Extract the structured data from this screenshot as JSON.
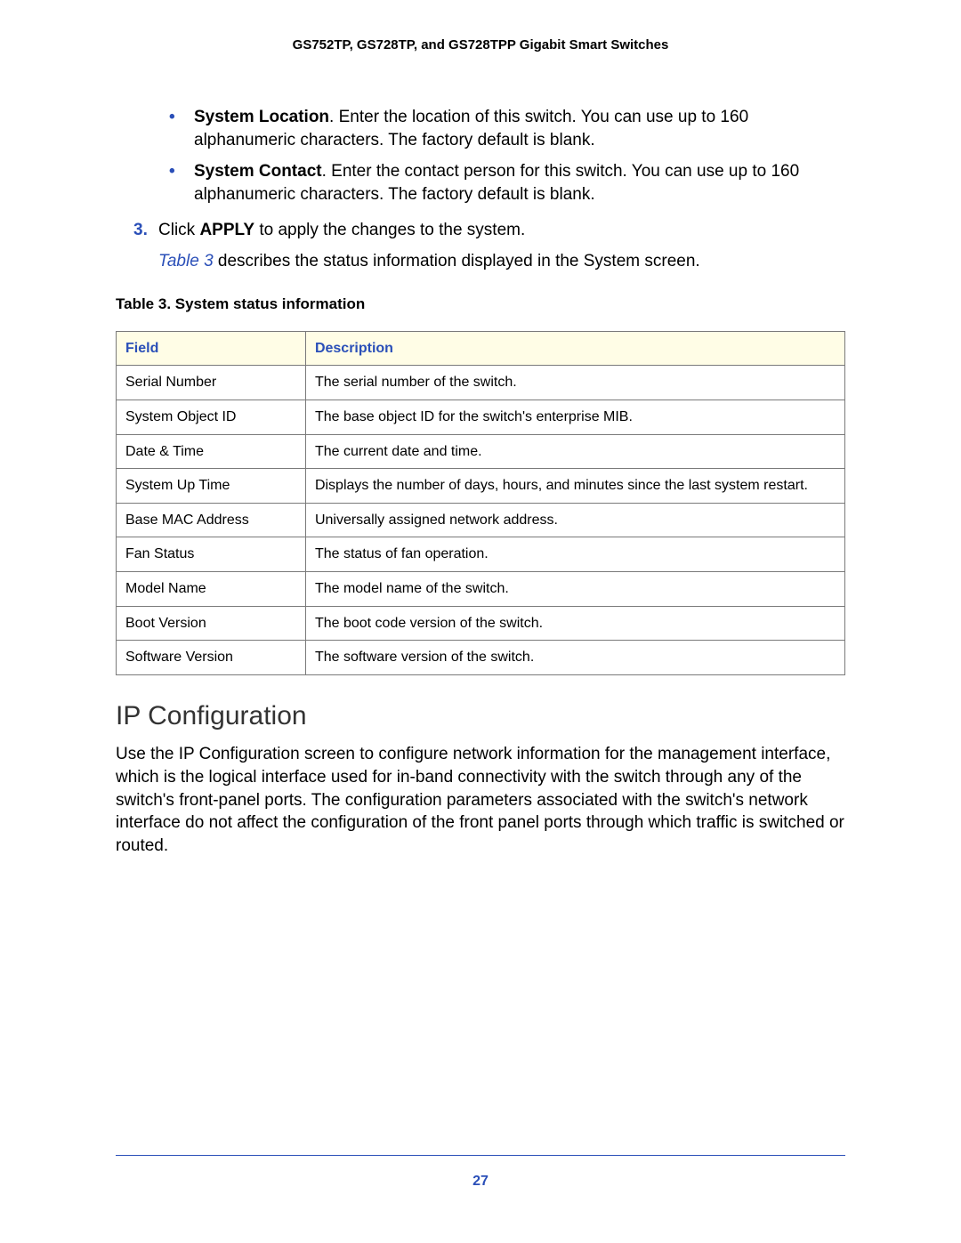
{
  "header": "GS752TP, GS728TP, and GS728TPP Gigabit Smart Switches",
  "bullets": [
    {
      "label": "System Location",
      "text": ". Enter the location of this switch. You can use up to 160 alphanumeric characters. The factory default is blank."
    },
    {
      "label": "System Contact",
      "text": ". Enter the contact person for this switch. You can use up to 160 alphanumeric characters. The factory default is blank."
    }
  ],
  "step": {
    "num": "3.",
    "pre": "Click ",
    "bold": "APPLY",
    "post": " to apply the changes to the system."
  },
  "after_step": {
    "ref": "Table 3",
    "rest": " describes the status information displayed in the System screen."
  },
  "table": {
    "caption": "Table 3.  System status information",
    "head": {
      "field": "Field",
      "desc": "Description"
    },
    "rows": [
      {
        "field": "Serial Number",
        "desc": "The serial number of the switch."
      },
      {
        "field": "System Object ID",
        "desc": "The base object ID for the switch's enterprise MIB."
      },
      {
        "field": "Date & Time",
        "desc": "The current date and time."
      },
      {
        "field": "System Up Time",
        "desc": "Displays the number of days, hours, and minutes since the last system restart."
      },
      {
        "field": "Base MAC Address",
        "desc": "Universally assigned network address."
      },
      {
        "field": "Fan Status",
        "desc": "The status of fan operation."
      },
      {
        "field": "Model Name",
        "desc": "The model name of the switch."
      },
      {
        "field": "Boot Version",
        "desc": "The boot code version of the switch."
      },
      {
        "field": "Software Version",
        "desc": "The software version of the switch."
      }
    ]
  },
  "section_heading": "IP Configuration",
  "section_para": "Use the IP Configuration screen to configure network information for the management interface, which is the logical interface used for in-band connectivity with the switch through any of the switch's front-panel ports. The configuration parameters associated with the switch's network interface do not affect the configuration of the front panel ports through which traffic is switched or routed.",
  "page_number": "27"
}
